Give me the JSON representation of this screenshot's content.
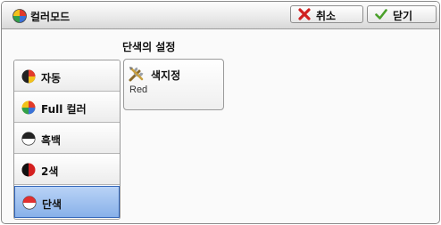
{
  "window": {
    "title": "컬러모드"
  },
  "buttons": {
    "cancel": "취소",
    "close": "닫기"
  },
  "section": {
    "title": "단색의 설정"
  },
  "mode_list": {
    "items": [
      {
        "label": "자동",
        "icon": "auto-color-icon"
      },
      {
        "label": "Full 컬러",
        "icon": "full-color-icon"
      },
      {
        "label": "흑백",
        "icon": "black-white-icon"
      },
      {
        "label": "2색",
        "icon": "two-color-icon"
      },
      {
        "label": "단색",
        "icon": "single-color-icon",
        "selected": true
      }
    ]
  },
  "color_setting": {
    "label": "색지정",
    "value": "Red"
  },
  "colors": {
    "selected_bg": "#88b1e9",
    "selected_border": "#2f63b8",
    "cancel_icon": "#d02020",
    "close_icon": "#4aa02a"
  }
}
